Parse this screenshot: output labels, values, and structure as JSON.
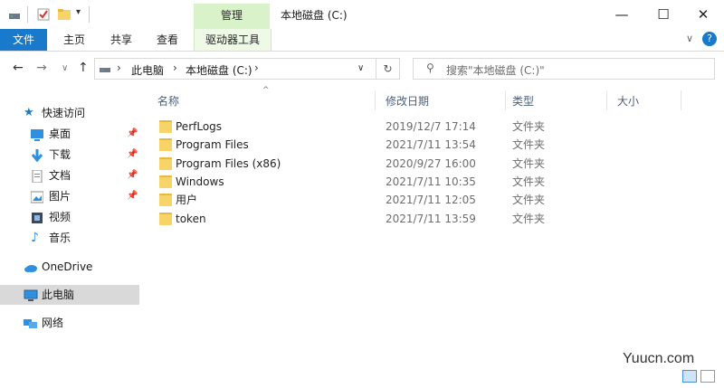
{
  "window": {
    "title": "本地磁盘 (C:)",
    "manage_tab": "管理"
  },
  "ribbon": {
    "tabs": [
      {
        "label": "文件"
      },
      {
        "label": "主页"
      },
      {
        "label": "共享"
      },
      {
        "label": "查看"
      },
      {
        "label": "驱动器工具"
      }
    ]
  },
  "address": {
    "breadcrumb": [
      "此电脑",
      "本地磁盘 (C:)"
    ],
    "search_placeholder": "搜索\"本地磁盘 (C:)\""
  },
  "sidebar": {
    "quick_access": "快速访问",
    "items": [
      {
        "label": "桌面",
        "pinned": true
      },
      {
        "label": "下载",
        "pinned": true
      },
      {
        "label": "文档",
        "pinned": true
      },
      {
        "label": "图片",
        "pinned": true
      },
      {
        "label": "视频",
        "pinned": false
      },
      {
        "label": "音乐",
        "pinned": false
      }
    ],
    "onedrive": "OneDrive",
    "this_pc": "此电脑",
    "network": "网络"
  },
  "columns": {
    "name": "名称",
    "date": "修改日期",
    "type": "类型",
    "size": "大小"
  },
  "files": [
    {
      "name": "PerfLogs",
      "date": "2019/12/7 17:14",
      "type": "文件夹"
    },
    {
      "name": "Program Files",
      "date": "2021/7/11 13:54",
      "type": "文件夹"
    },
    {
      "name": "Program Files (x86)",
      "date": "2020/9/27 16:00",
      "type": "文件夹"
    },
    {
      "name": "Windows",
      "date": "2021/7/11 10:35",
      "type": "文件夹"
    },
    {
      "name": "用户",
      "date": "2021/7/11 12:05",
      "type": "文件夹"
    },
    {
      "name": "token",
      "date": "2021/7/11 13:59",
      "type": "文件夹"
    }
  ],
  "watermark": "Yuucn.com",
  "colors": {
    "file_tab": "#1979ca",
    "manage_tab": "#d9f2c9",
    "folder": "#f7d46a",
    "selected": "#d9d9d9"
  }
}
